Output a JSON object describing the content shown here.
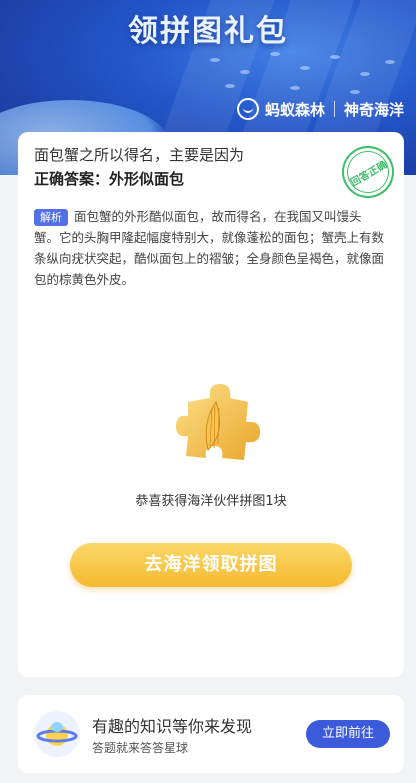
{
  "header": {
    "title": "领拼图礼包",
    "brand_left": "蚂蚁森林",
    "brand_right": "神奇海洋"
  },
  "question": {
    "text": "面包蟹之所以得名，主要是因为",
    "answer": "正确答案：外形似面包",
    "stamp_label": "回答正确"
  },
  "analysis": {
    "tag": "解析",
    "text": "面包蟹的外形酷似面包，故而得名，在我国又叫馒头蟹。它的头胸甲隆起幅度特别大，就像蓬松的面包；蟹壳上有数条纵向疣状突起，酷似面包上的褶皱；全身颜色呈褐色，就像面包的棕黄色外皮。"
  },
  "reward": {
    "icon": "puzzle-piece-icon",
    "text": "恭喜获得海洋伙伴拼图1块",
    "button_label": "去海洋领取拼图"
  },
  "promo": {
    "title": "有趣的知识等你来发现",
    "subtitle": "答题就来答答星球",
    "button_label": "立即前往"
  },
  "colors": {
    "accent_blue": "#3b5bdb",
    "cta_yellow": "#f5b92f",
    "correct_green": "#3fbf6a"
  }
}
